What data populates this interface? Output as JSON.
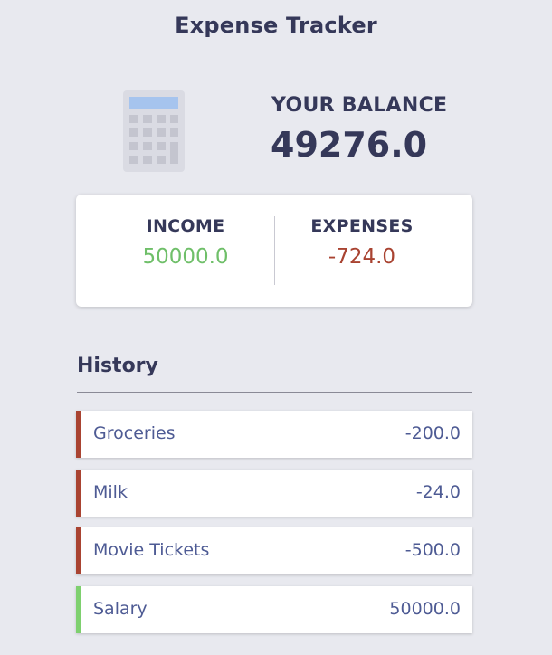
{
  "app": {
    "title": "Expense Tracker"
  },
  "balance": {
    "label": "YOUR BALANCE",
    "value": "49276.0",
    "icon": "calculator-icon"
  },
  "summary": {
    "income_label": "INCOME",
    "income_value": "50000.0",
    "expenses_label": "EXPENSES",
    "expenses_value": "-724.0"
  },
  "history": {
    "title": "History",
    "items": [
      {
        "name": "Groceries",
        "amount": "-200.0",
        "type": "expense"
      },
      {
        "name": "Milk",
        "amount": "-24.0",
        "type": "expense"
      },
      {
        "name": "Movie Tickets",
        "amount": "-500.0",
        "type": "expense"
      },
      {
        "name": "Salary",
        "amount": "50000.0",
        "type": "income"
      }
    ]
  },
  "colors": {
    "background": "#e8e9ef",
    "text": "#353859",
    "income": "#6fbf69",
    "expense": "#a94331",
    "income_border": "#7ed06f",
    "item_text": "#4e5b94"
  }
}
